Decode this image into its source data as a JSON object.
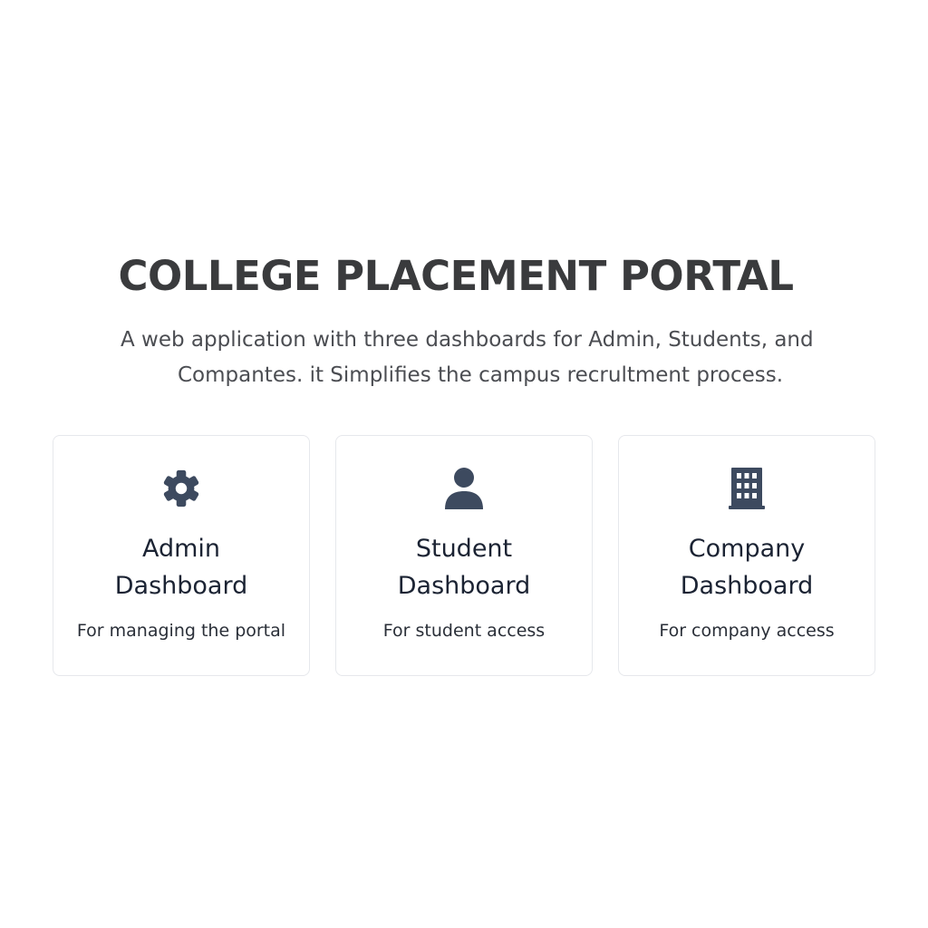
{
  "header": {
    "title": "COLLEGE PLACEMENT PORTAL",
    "subtitle_line1": "A web application with three dashboards for Admin, Students, and",
    "subtitle_line2": "Compantes. it Simplifies the campus recrultment process."
  },
  "cards": [
    {
      "icon": "gear-icon",
      "title_line1": "Admin",
      "title_line2": "Dashboard",
      "description": "For managing the portal"
    },
    {
      "icon": "user-icon",
      "title_line1": "Student",
      "title_line2": "Dashboard",
      "description": "For student access"
    },
    {
      "icon": "building-icon",
      "title_line1": "Company",
      "title_line2": "Dashboard",
      "description": "For company access"
    }
  ],
  "colors": {
    "title": "#3a3b3d",
    "subtitle": "#4b4d52",
    "icon": "#3d4a5f",
    "card_title": "#1b2333",
    "card_border": "#e6e8ec"
  }
}
